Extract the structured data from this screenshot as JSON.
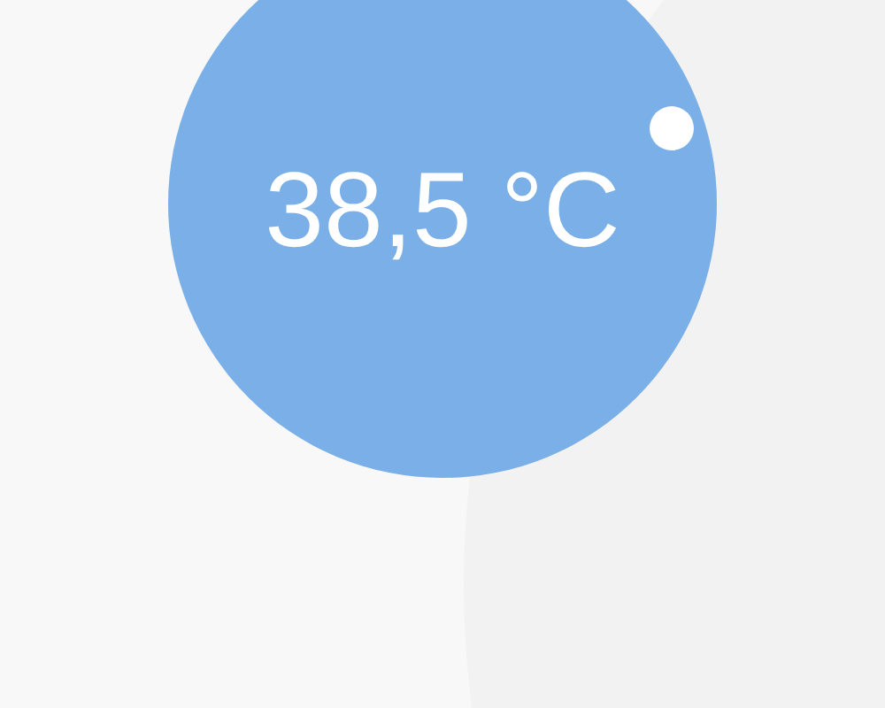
{
  "thermostat": {
    "reading": "38,5 °C"
  }
}
